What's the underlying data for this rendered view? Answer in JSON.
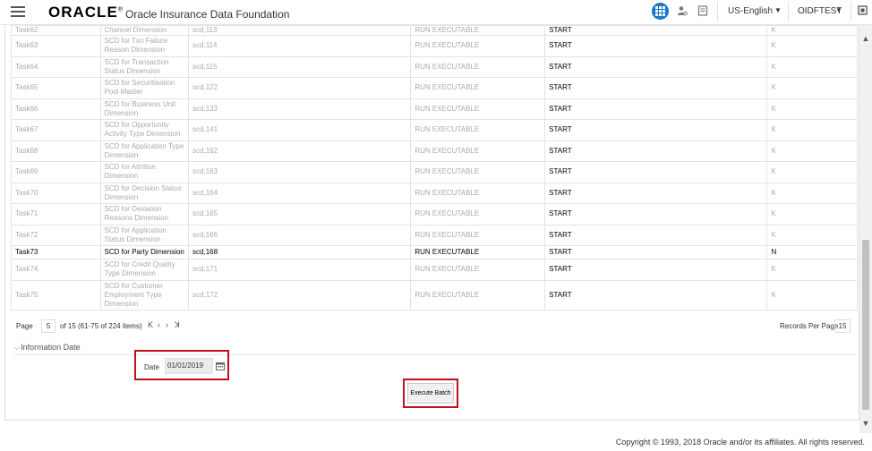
{
  "header": {
    "logo": "ORACLE",
    "logo_mark": "®",
    "product": "Oracle Insurance Data Foundation",
    "language": "US-English",
    "user": "OIDFTEST"
  },
  "rows": [
    {
      "task": "Task62",
      "desc": "Channel Dimension",
      "cmd": "scd,113",
      "type": "RUN EXECUTABLE",
      "action": "START",
      "flag": "K",
      "active": false,
      "cls": "first"
    },
    {
      "task": "Task63",
      "desc": "SCD for Txn Failure Reason Dimension",
      "cmd": "scd,114",
      "type": "RUN EXECUTABLE",
      "action": "START",
      "flag": "K",
      "active": false,
      "cls": ""
    },
    {
      "task": "Task64",
      "desc": "SCD for Transaction Status Dimension",
      "cmd": "scd,115",
      "type": "RUN EXECUTABLE",
      "action": "START",
      "flag": "K",
      "active": false,
      "cls": ""
    },
    {
      "task": "Task65",
      "desc": "SCD for Securitisation Pool Master",
      "cmd": "scd,122",
      "type": "RUN EXECUTABLE",
      "action": "START",
      "flag": "K",
      "active": false,
      "cls": ""
    },
    {
      "task": "Task66",
      "desc": "SCD for Business Unit Dimension",
      "cmd": "scd,133",
      "type": "RUN EXECUTABLE",
      "action": "START",
      "flag": "K",
      "active": false,
      "cls": ""
    },
    {
      "task": "Task67",
      "desc": "SCD for Opportunity Activity Type Dimension",
      "cmd": "scd,141",
      "type": "RUN EXECUTABLE",
      "action": "START",
      "flag": "K",
      "active": false,
      "cls": ""
    },
    {
      "task": "Task68",
      "desc": "SCD for Application Type Dimension",
      "cmd": "scd,162",
      "type": "RUN EXECUTABLE",
      "action": "START",
      "flag": "K",
      "active": false,
      "cls": ""
    },
    {
      "task": "Task69",
      "desc": "SCD for Attrition Dimension",
      "cmd": "scd,163",
      "type": "RUN EXECUTABLE",
      "action": "START",
      "flag": "K",
      "active": false,
      "cls": ""
    },
    {
      "task": "Task70",
      "desc": "SCD for Decision Status Dimension",
      "cmd": "scd,164",
      "type": "RUN EXECUTABLE",
      "action": "START",
      "flag": "K",
      "active": false,
      "cls": ""
    },
    {
      "task": "Task71",
      "desc": "SCD for Deviation Reasons Dimension",
      "cmd": "scd,165",
      "type": "RUN EXECUTABLE",
      "action": "START",
      "flag": "K",
      "active": false,
      "cls": ""
    },
    {
      "task": "Task72",
      "desc": "SCD for Application Status Dimension",
      "cmd": "scd,166",
      "type": "RUN EXECUTABLE",
      "action": "START",
      "flag": "K",
      "active": false,
      "cls": ""
    },
    {
      "task": "Task73",
      "desc": "SCD for Party Dimension",
      "cmd": "scd,168",
      "type": "RUN EXECUTABLE",
      "action": "START",
      "flag": "N",
      "active": true,
      "cls": "short"
    },
    {
      "task": "Task74",
      "desc": "SCD for Credit Quality Type Dimension",
      "cmd": "scd,171",
      "type": "RUN EXECUTABLE",
      "action": "START",
      "flag": "K",
      "active": false,
      "cls": ""
    },
    {
      "task": "Task75",
      "desc": "SCD for Customer Employment Type Dimension",
      "cmd": "scd,172",
      "type": "RUN EXECUTABLE",
      "action": "START",
      "flag": "K",
      "active": false,
      "cls": "tall"
    }
  ],
  "pager": {
    "page_label": "Page",
    "page": "5",
    "summary": "of 15 (61-75 of 224 items)",
    "rpp_label": "Records Per Page",
    "rpp": "15"
  },
  "section": {
    "title": "Information Date"
  },
  "date": {
    "label": "Date",
    "value": "01/01/2019"
  },
  "execute_label": "Execute Batch",
  "footer": "Copyright © 1993, 2018 Oracle and/or its affiliates. All rights reserved."
}
